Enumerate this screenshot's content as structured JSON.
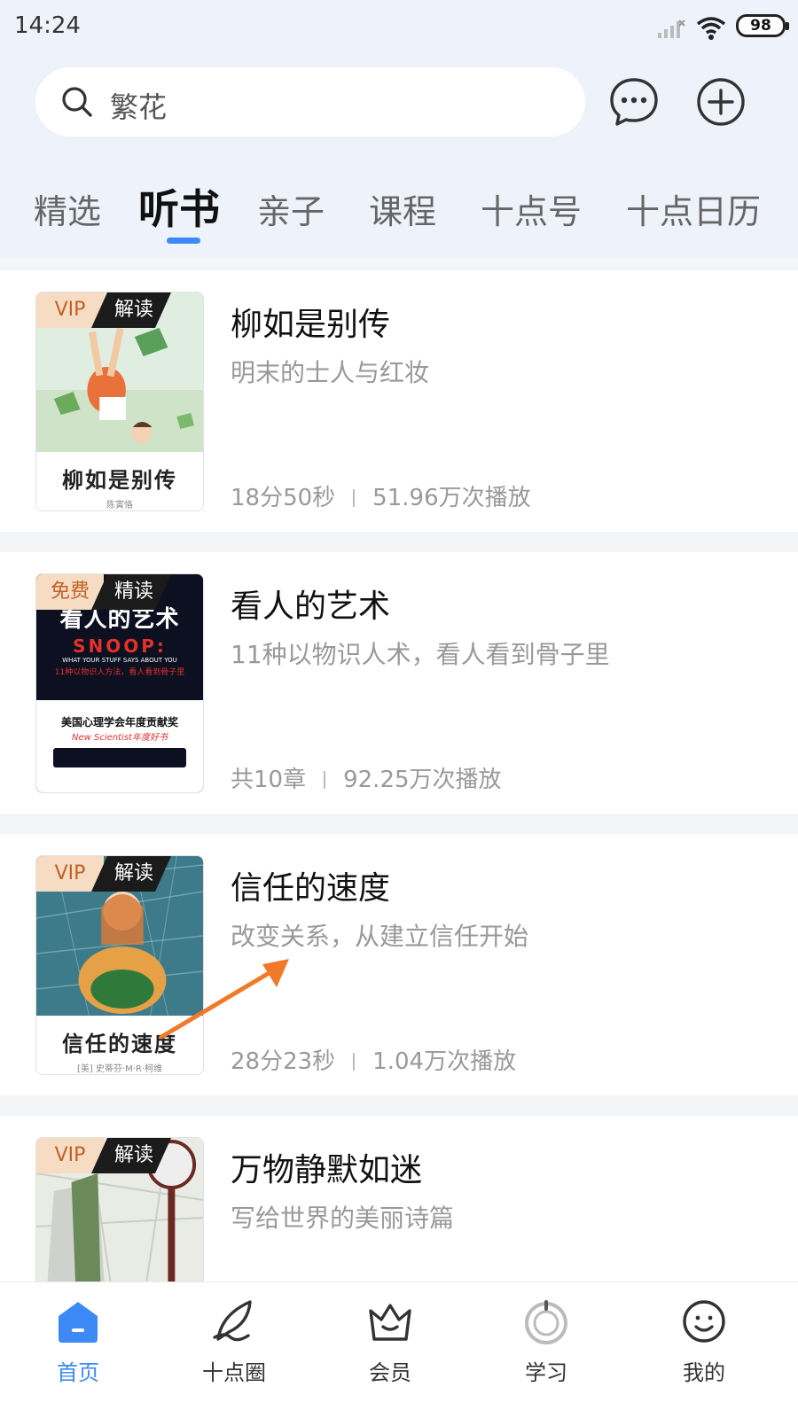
{
  "status_bar": {
    "time": "14:24",
    "battery": "98"
  },
  "search": {
    "text": "繁花"
  },
  "header_icons": [
    "chat-bubble-icon",
    "plus-circle-icon"
  ],
  "tabs": [
    {
      "label": "精选",
      "active": false
    },
    {
      "label": "听书",
      "active": true
    },
    {
      "label": "亲子",
      "active": false
    },
    {
      "label": "课程",
      "active": false
    },
    {
      "label": "十点号",
      "active": false
    },
    {
      "label": "十点日历",
      "active": false
    }
  ],
  "books": [
    {
      "title": "柳如是别传",
      "subtitle": "明末的士人与红妆",
      "meta_left": "18分50秒",
      "meta_right": "51.96万次播放",
      "badge_left": "VIP",
      "badge_right": "解读",
      "cover_title": "柳如是别传",
      "cover_author": "陈寅恪"
    },
    {
      "title": "看人的艺术",
      "subtitle": "11种以物识人术，看人看到骨子里",
      "meta_left": "共10章",
      "meta_right": "92.25万次播放",
      "badge_left": "免费",
      "badge_right": "精读",
      "cover_title": "看人的艺术",
      "cover_snoop": "SNOOP:",
      "cover_eng": "WHAT YOUR STUFF SAYS ABOUT YOU",
      "cover_tag": "11种以物识人方法，看人看到骨子里",
      "cover_award": "美国心理学会年度贡献奖",
      "cover_award2": "New Scientist年度好书"
    },
    {
      "title": "信任的速度",
      "subtitle": "改变关系，从建立信任开始",
      "meta_left": "28分23秒",
      "meta_right": "1.04万次播放",
      "badge_left": "VIP",
      "badge_right": "解读",
      "cover_title": "信任的速度",
      "cover_author": "[美] 史蒂芬·M·R·柯维"
    },
    {
      "title": "万物静默如迷",
      "subtitle": "写给世界的美丽诗篇",
      "badge_left": "VIP",
      "badge_right": "解读"
    }
  ],
  "bottom_nav": [
    {
      "label": "首页",
      "icon": "home-icon",
      "active": true
    },
    {
      "label": "十点圈",
      "icon": "feather-icon",
      "active": false
    },
    {
      "label": "会员",
      "icon": "crown-icon",
      "active": false
    },
    {
      "label": "学习",
      "icon": "study-icon",
      "active": false
    },
    {
      "label": "我的",
      "icon": "profile-icon",
      "active": false
    }
  ],
  "colors": {
    "accent": "#3d8af7",
    "annotation_arrow": "#f07a2a",
    "vip_badge": "#c1612a"
  }
}
